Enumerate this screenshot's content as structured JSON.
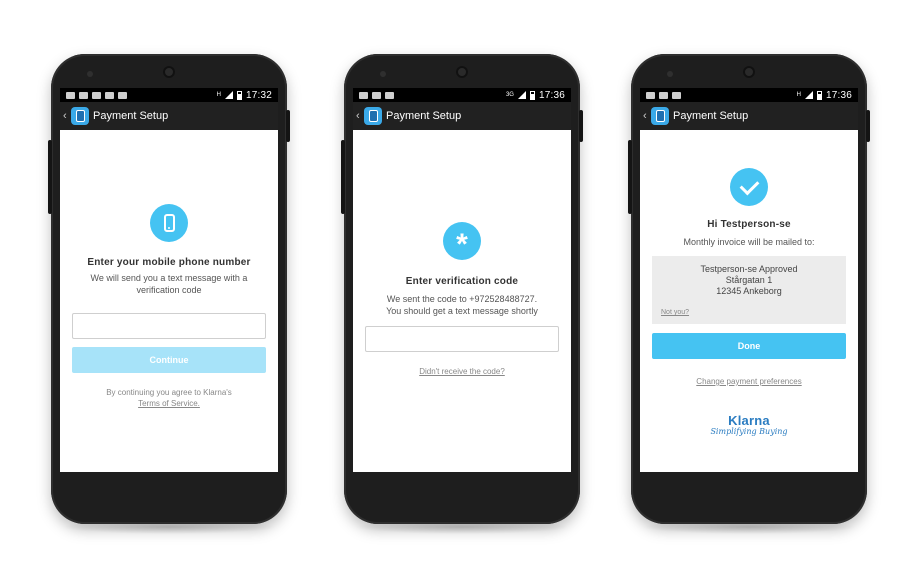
{
  "common": {
    "back": "‹",
    "title": "Payment Setup"
  },
  "screens": [
    {
      "time": "17:32",
      "network": "H",
      "icon": "phone-icon",
      "heading": "Enter your mobile phone number",
      "subtext": "We will send you a text message with a verification code",
      "input_value": "",
      "button_label": "Continue",
      "terms_prefix": "By continuing you agree to Klarna's",
      "terms_link": "Terms of Service."
    },
    {
      "time": "17:36",
      "network": "3G",
      "icon": "asterisk-icon",
      "icon_glyph": "*",
      "heading": "Enter verification code",
      "subtext_line1": "We sent the code to +972528488727.",
      "subtext_line2": "You should get a text message shortly",
      "input_value": "",
      "link": "Didn't receive the code?"
    },
    {
      "time": "17:36",
      "network": "H",
      "icon": "check-icon",
      "heading": "Hi Testperson-se",
      "subtext": "Monthly invoice will be mailed to:",
      "address": [
        "Testperson-se Approved",
        "Stårgatan 1",
        "12345 Ankeborg"
      ],
      "not_you": "Not you?",
      "button_label": "Done",
      "link": "Change payment preferences",
      "logo_name": "Klarna",
      "logo_tagline": "Simplifying Buying"
    }
  ],
  "colors": {
    "accent": "#45c3f2",
    "accent_disabled": "#a7e3f9",
    "actionbar": "#212121",
    "brand_blue": "#2a7cc1"
  }
}
